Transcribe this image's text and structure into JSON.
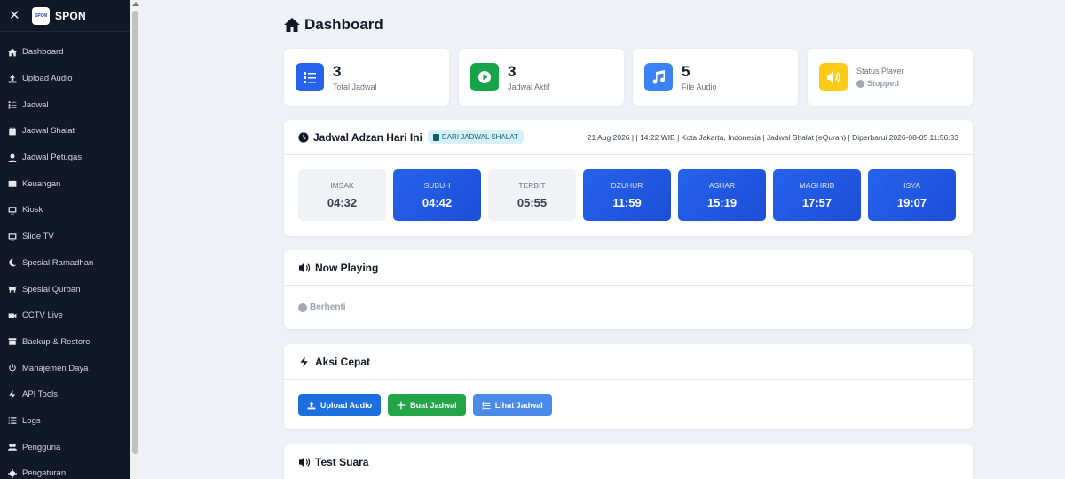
{
  "sidebar": {
    "close_glyph": "✕",
    "logo_text": "SPON",
    "brand": "SPON",
    "items": [
      {
        "label": "Dashboard",
        "icon": "home-icon"
      },
      {
        "label": "Upload Audio",
        "icon": "upload-icon"
      },
      {
        "label": "Jadwal",
        "icon": "list-check-icon"
      },
      {
        "label": "Jadwal Shalat",
        "icon": "calendar-icon"
      },
      {
        "label": "Jadwal Petugas",
        "icon": "user-icon"
      },
      {
        "label": "Keuangan",
        "icon": "wallet-icon"
      },
      {
        "label": "Kiosk",
        "icon": "monitor-icon"
      },
      {
        "label": "Slide TV",
        "icon": "tv-icon"
      },
      {
        "label": "Spesial Ramadhan",
        "icon": "moon-icon"
      },
      {
        "label": "Spesial Qurban",
        "icon": "cow-icon"
      },
      {
        "label": "CCTV Live",
        "icon": "video-icon"
      },
      {
        "label": "Backup & Restore",
        "icon": "archive-icon"
      },
      {
        "label": "Manajemen Daya",
        "icon": "power-icon"
      },
      {
        "label": "API Tools",
        "icon": "bolt-icon"
      },
      {
        "label": "Logs",
        "icon": "list-icon"
      },
      {
        "label": "Pengguna",
        "icon": "users-icon"
      },
      {
        "label": "Pengaturan",
        "icon": "gear-icon"
      }
    ]
  },
  "header": {
    "title": "Dashboard"
  },
  "stats": [
    {
      "value": "3",
      "label": "Total Jadwal",
      "color": "#2563eb",
      "icon": "list-check-icon"
    },
    {
      "value": "3",
      "label": "Jadwal Aktif",
      "color": "#16a34a",
      "icon": "play-icon"
    },
    {
      "value": "5",
      "label": "File Audio",
      "color": "#3b82f6",
      "icon": "music-icon"
    },
    {
      "value": "",
      "label": "Status Player",
      "status": "Stopped",
      "color": "#facc15",
      "icon": "volume-icon"
    }
  ],
  "schedule": {
    "title": "Jadwal Adzan Hari Ini",
    "badge": "DARI JADWAL SHALAT",
    "info": "21 Aug 2026 | | 14:22 WIB | Kota Jakarta, Indonesia | Jadwal Shalat (eQuran) | Diperbarui 2026-08-05 11:56:33",
    "prayers": [
      {
        "name": "IMSAK",
        "time": "04:32",
        "active": false
      },
      {
        "name": "SUBUH",
        "time": "04:42",
        "active": true
      },
      {
        "name": "TERBIT",
        "time": "05:55",
        "active": false
      },
      {
        "name": "DZUHUR",
        "time": "11:59",
        "active": true
      },
      {
        "name": "ASHAR",
        "time": "15:19",
        "active": true
      },
      {
        "name": "MAGHRIB",
        "time": "17:57",
        "active": true
      },
      {
        "name": "ISYA",
        "time": "19:07",
        "active": true
      }
    ]
  },
  "now_playing": {
    "title": "Now Playing",
    "status": "Berhenti"
  },
  "quick_actions": {
    "title": "Aksi Cepat",
    "buttons": [
      {
        "label": "Upload Audio",
        "color": "#1d6fe0"
      },
      {
        "label": "Buat Jadwal",
        "color": "#22a447"
      },
      {
        "label": "Lihat Jadwal",
        "color": "#4a8ae8"
      }
    ]
  },
  "test_sound": {
    "title": "Test Suara"
  }
}
